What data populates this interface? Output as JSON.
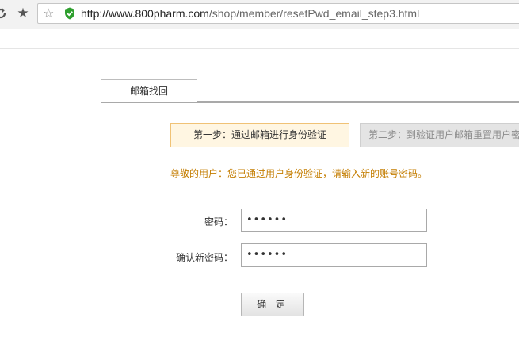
{
  "browser": {
    "url_host": "http://www.800pharm.com",
    "url_path": "/shop/member/resetPwd_email_step3.html",
    "bookmark_icon": "star-filled",
    "secure_icon": "shield-check",
    "secure_color": "#2e9f2e"
  },
  "tabs": [
    {
      "label": "邮箱找回",
      "active": true
    }
  ],
  "steps": [
    {
      "label": "第一步：通过邮箱进行身份验证",
      "active": true
    },
    {
      "label": "第二步：到验证用户邮箱重置用户密",
      "active": false
    }
  ],
  "notice": "尊敬的用户：您已通过用户身份验证，请输入新的账号密码。",
  "form": {
    "password_label": "密码：",
    "password_value": "••••••",
    "confirm_label": "确认新密码：",
    "confirm_value": "••••••",
    "submit_label": "确 定"
  },
  "colors": {
    "notice_text": "#c47d00",
    "active_step_bg": "#fff6e2",
    "active_step_border": "#f0c276",
    "inactive_step_bg": "#e4e4e4"
  }
}
